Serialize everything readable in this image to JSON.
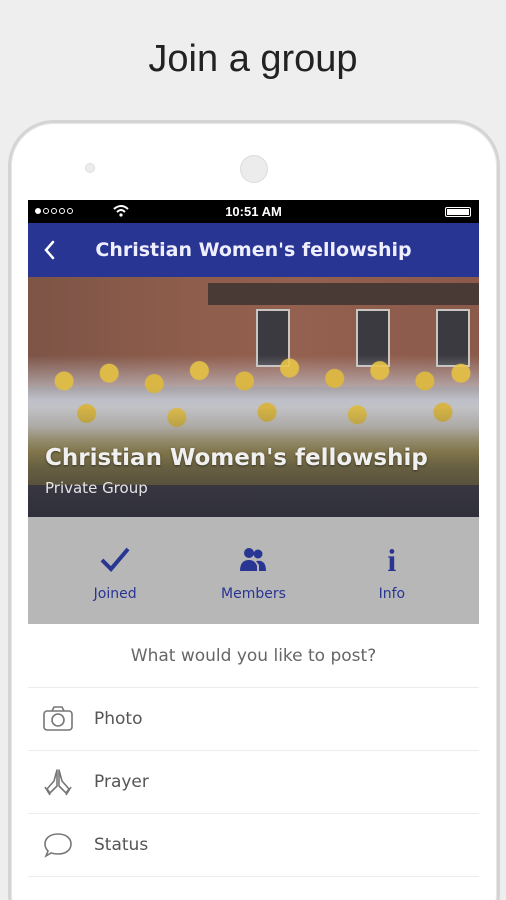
{
  "headline": "Join a group",
  "status_bar": {
    "time": "10:51 AM"
  },
  "nav": {
    "title": "Christian Women's fellowship"
  },
  "group": {
    "name": "Christian Women's fellowship",
    "privacy": "Private Group"
  },
  "actions": [
    {
      "label": "Joined",
      "icon": "checkmark-icon"
    },
    {
      "label": "Members",
      "icon": "members-icon"
    },
    {
      "label": "Info",
      "icon": "info-icon"
    }
  ],
  "composer": {
    "prompt": "What would you like to post?",
    "options": [
      {
        "label": "Photo",
        "icon": "camera-icon"
      },
      {
        "label": "Prayer",
        "icon": "praying-hands-icon"
      },
      {
        "label": "Status",
        "icon": "speech-bubble-icon"
      }
    ]
  },
  "colors": {
    "brand": "#283593",
    "action_bar": "#b7b7b7",
    "background": "#eeeeee"
  }
}
